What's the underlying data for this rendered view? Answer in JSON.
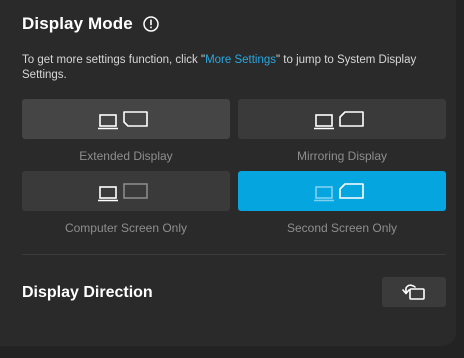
{
  "display_mode": {
    "title": "Display Mode",
    "description_before": "To get more settings function, click \"",
    "link_text": "More Settings",
    "description_after": "\" to jump to System Display Settings.",
    "options": [
      {
        "label": "Extended Display",
        "icon": "extended-display-icon",
        "selected": false
      },
      {
        "label": "Mirroring Display",
        "icon": "mirroring-display-icon",
        "selected": false
      },
      {
        "label": "Computer Screen Only",
        "icon": "computer-screen-only-icon",
        "selected": false
      },
      {
        "label": "Second Screen Only",
        "icon": "second-screen-only-icon",
        "selected": true
      }
    ]
  },
  "display_direction": {
    "title": "Display Direction",
    "button_icon": "rotate-screen-icon"
  },
  "colors": {
    "accent": "#05a6e0",
    "link": "#29a8e0",
    "background": "#2a2a2a",
    "tile": "#3a3a3a"
  }
}
